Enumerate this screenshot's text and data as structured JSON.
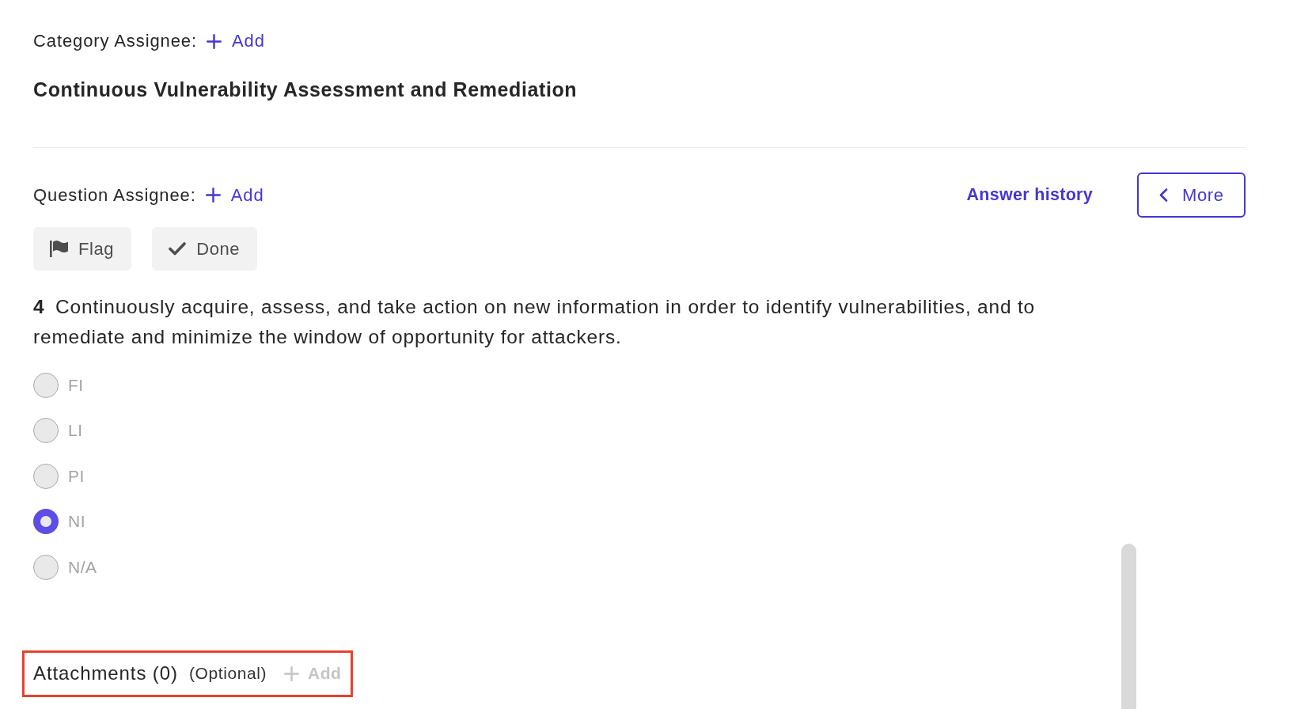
{
  "category": {
    "assignee_label": "Category Assignee:",
    "add_label": "Add",
    "title": "Continuous Vulnerability Assessment and Remediation"
  },
  "question_bar": {
    "assignee_label": "Question Assignee:",
    "add_label": "Add",
    "answer_history": "Answer history",
    "more_button": "More"
  },
  "actions": [
    {
      "kind": "flag",
      "label": "Flag"
    },
    {
      "kind": "done",
      "label": "Done"
    }
  ],
  "question": {
    "text": "**4** Continuously acquire, assess, and take action on new information in order to identify vulnerabilities, and to remediate and minimize the window of opportunity for attackers."
  },
  "options": [
    {
      "label": "FI",
      "selected": false
    },
    {
      "label": "LI",
      "selected": false
    },
    {
      "label": "PI",
      "selected": false
    },
    {
      "label": "NI",
      "selected": true
    },
    {
      "label": "N/A",
      "selected": false
    }
  ],
  "attachments": {
    "label": "Attachments (0)",
    "note": "(Optional)",
    "add_label": "Add",
    "add_disabled": true,
    "highlighted": true
  }
}
